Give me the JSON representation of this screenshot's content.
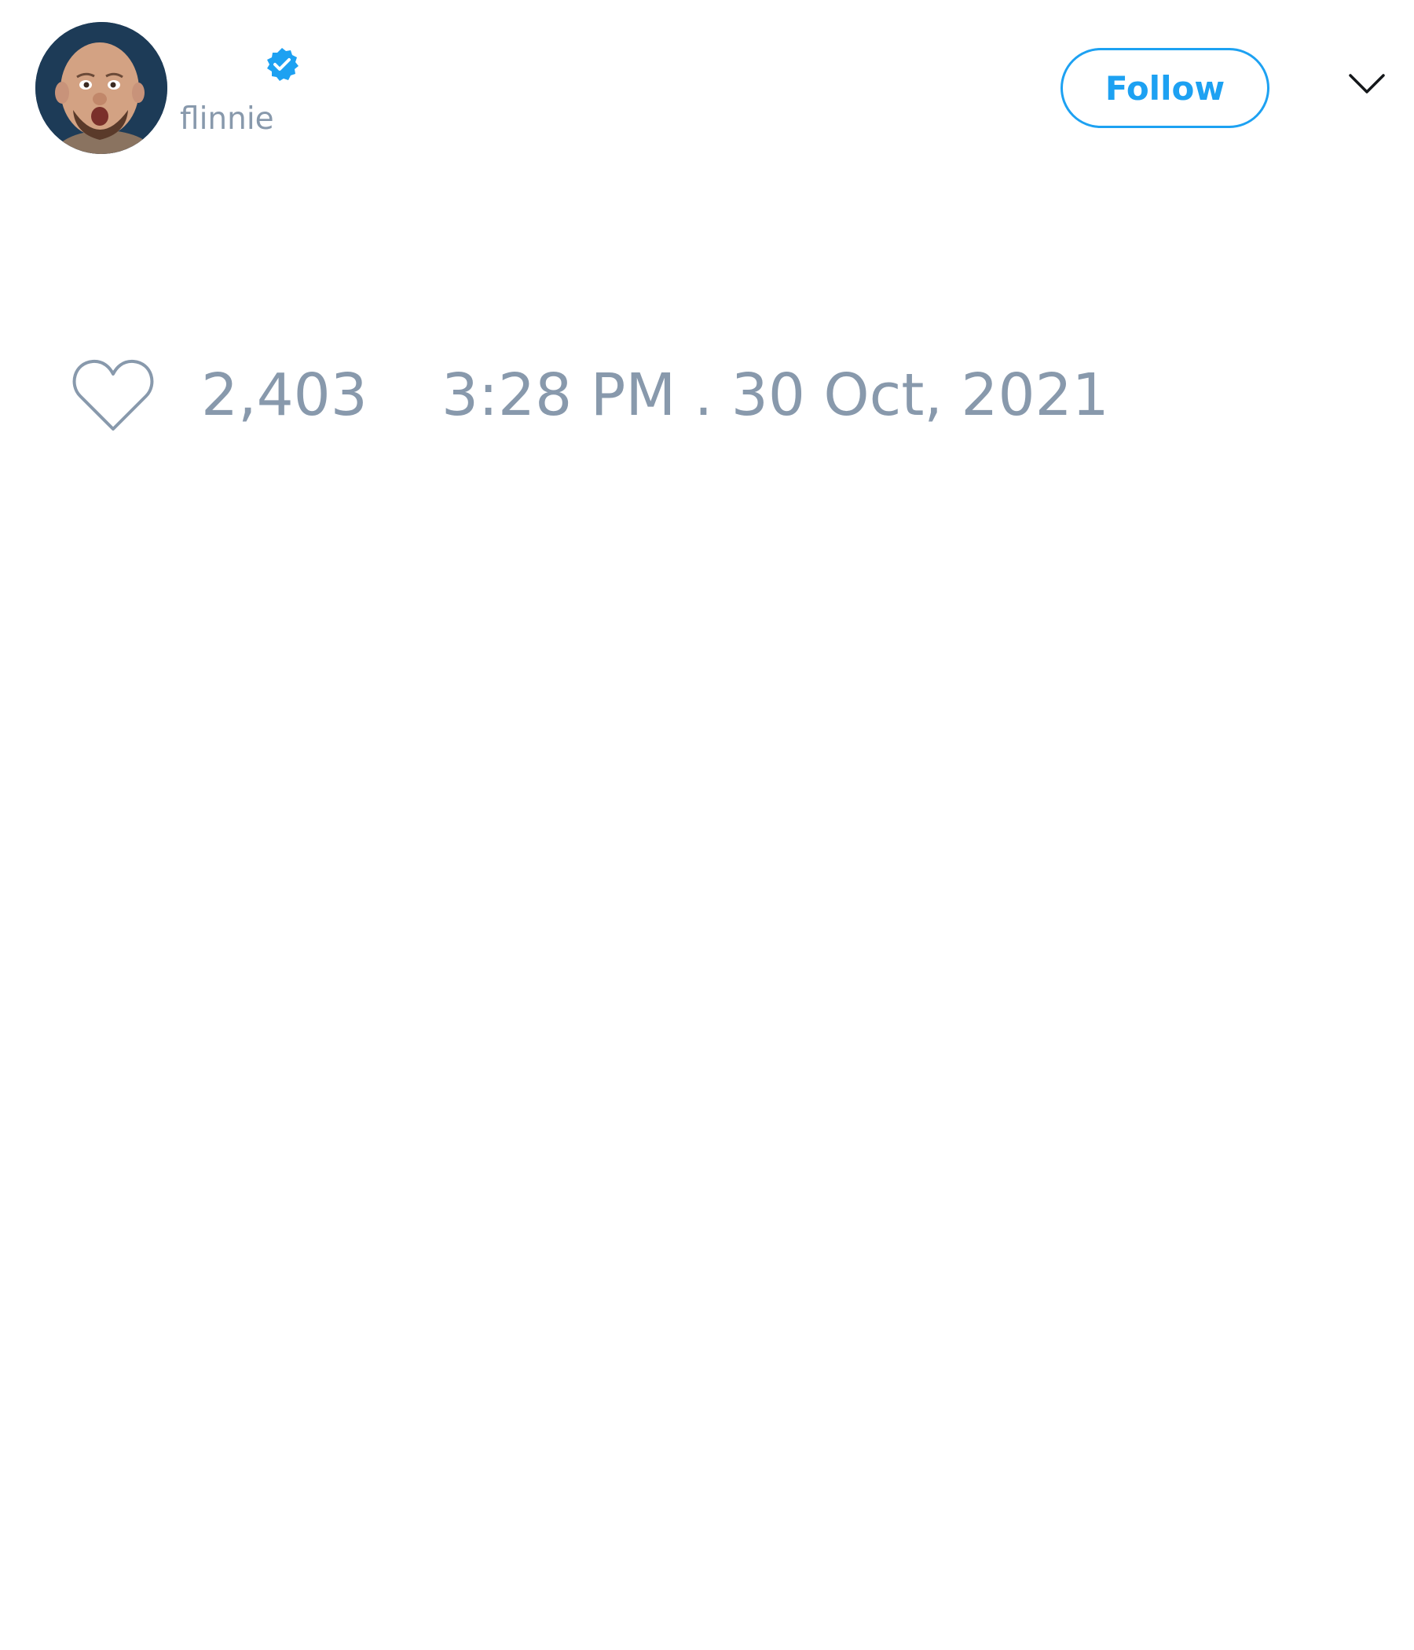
{
  "author": {
    "display_name": "",
    "handle": "flinnie",
    "verified": true
  },
  "header": {
    "follow_label": "Follow",
    "menu_icon": "chevron-down-icon"
  },
  "engagement": {
    "like_icon": "heart-icon",
    "like_count": "2,403"
  },
  "timestamp": "3:28 PM . 30 Oct, 2021",
  "colors": {
    "accent": "#1da1f2",
    "muted_text": "#8899ac",
    "background": "#ffffff"
  }
}
